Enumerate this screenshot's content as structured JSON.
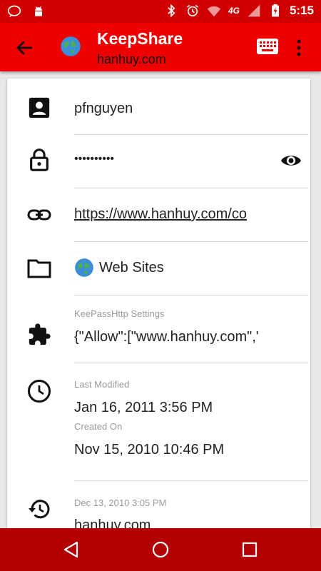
{
  "status_bar": {
    "time": "5:15",
    "network": "4G"
  },
  "app_bar": {
    "title": "KeepShare",
    "subtitle": "hanhuy.com"
  },
  "entry": {
    "username": "pfnguyen",
    "password_masked": "••••••••••",
    "url": "https://www.hanhuy.com/co",
    "group": "Web Sites",
    "keepass_label": "KeePassHttp Settings",
    "keepass_value": "{\"Allow\":[\"www.hanhuy.com\",'",
    "last_modified_label": "Last Modified",
    "last_modified_value": "Jan 16, 2011 3:56 PM",
    "created_label": "Created On",
    "created_value": "Nov 15, 2010 10:46 PM",
    "history_label": "Dec 13, 2010 3:05 PM",
    "history_value": "hanhuy.com"
  },
  "colors": {
    "status_bar": "#d10000",
    "app_bar": "#ee0000",
    "nav_bar": "#b30000",
    "link": "#009688"
  }
}
